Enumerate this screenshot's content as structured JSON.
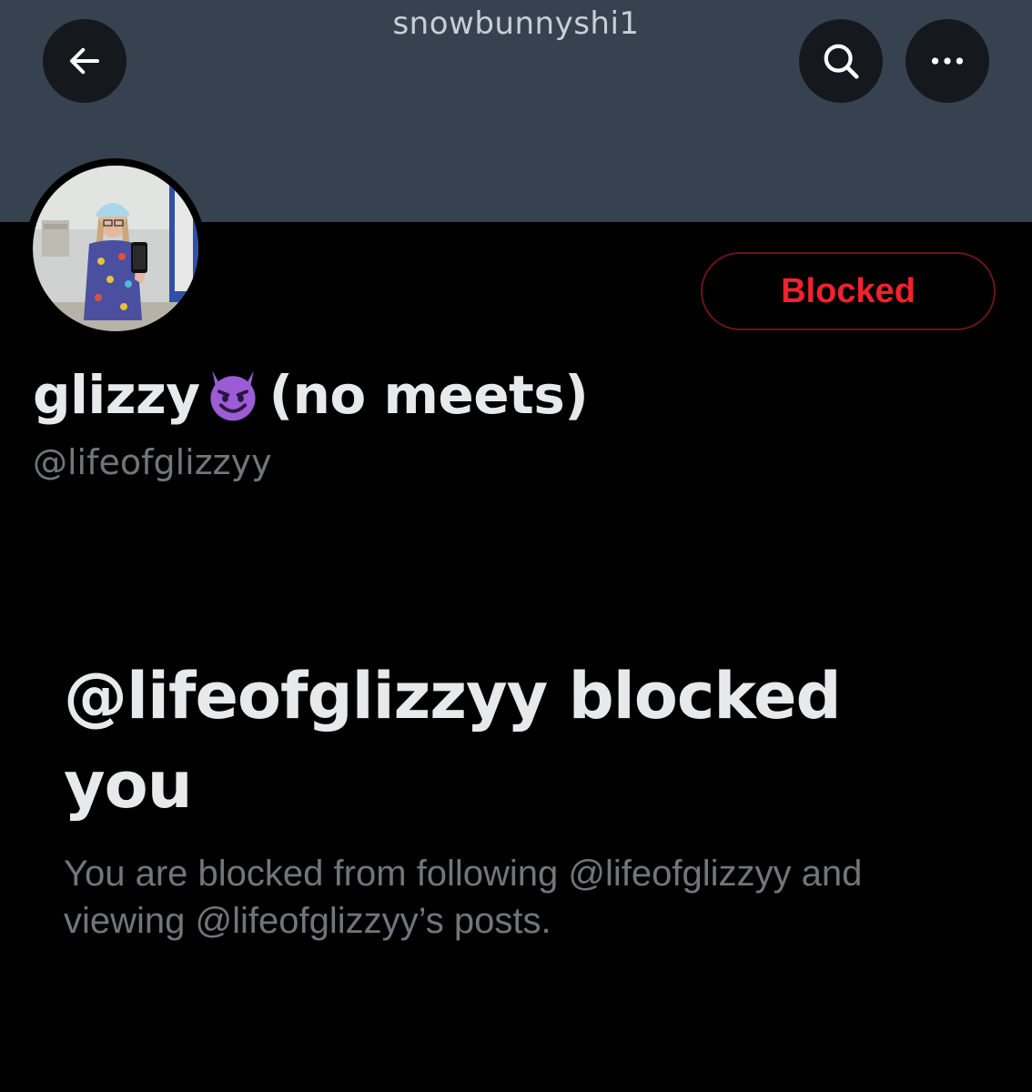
{
  "header": {
    "username": "snowbunnyshi1",
    "back_icon": "arrow-left-icon",
    "search_icon": "search-icon",
    "more_icon": "more-horizontal-icon",
    "banner_color": "#374250"
  },
  "profile": {
    "display_name_before": "glizzy",
    "display_name_emoji": "smiling-devil-icon",
    "display_name_after": "(no meets)",
    "handle": "@lifeofglizzyy",
    "relationship_button": "Blocked",
    "button_color": "#f4212e"
  },
  "blocked_notice": {
    "heading": "@lifeofglizzyy blocked you",
    "description": "You are blocked from following @lifeofglizzyy and viewing @lifeofglizzyy’s posts."
  }
}
